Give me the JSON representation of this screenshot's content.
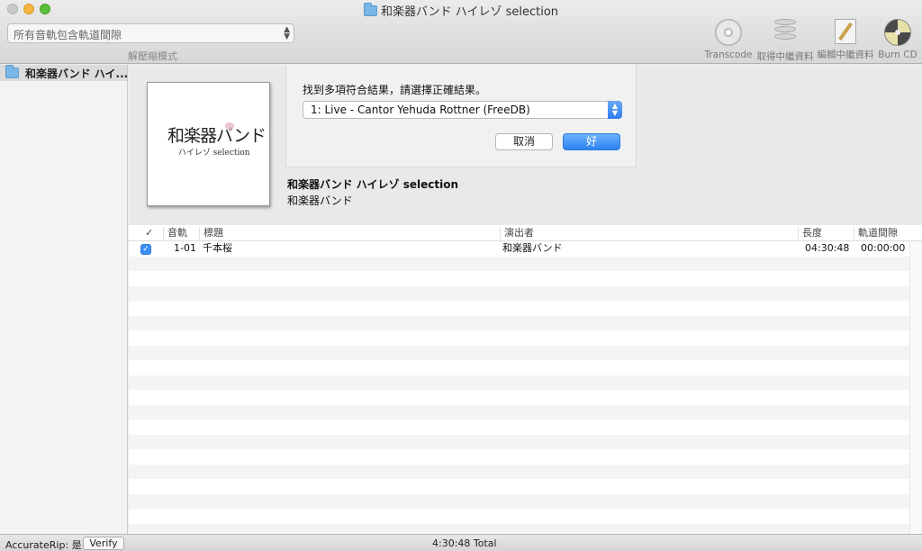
{
  "window": {
    "title": "和楽器バンド ハイレゾ selection"
  },
  "toolbar": {
    "mode_select_value": "所有音軌包含軌道間隙",
    "mode_caption": "解壓縮模式",
    "buttons": [
      {
        "label": "Transcode",
        "icon": "cd-icon"
      },
      {
        "label": "取得中繼資料",
        "icon": "database-icon"
      },
      {
        "label": "編輯中繼資料",
        "icon": "notepad-icon"
      },
      {
        "label": "Burn CD",
        "icon": "burn-cd-icon"
      }
    ]
  },
  "sidebar": {
    "items": [
      {
        "label": "和楽器バンド ハイ..."
      }
    ]
  },
  "album": {
    "cover_text_main": "和楽器バンド",
    "cover_text_sub": "ハイレゾ selection",
    "title": "和楽器バンド ハイレゾ selection",
    "artist": "和楽器バンド"
  },
  "sheet": {
    "message": "找到多項符合結果，請選擇正確結果。",
    "selected_result": "1: Live - Cantor Yehuda Rottner (FreeDB)",
    "cancel_label": "取消",
    "ok_label": "好"
  },
  "table": {
    "columns": {
      "check": "✓",
      "track": "音軌",
      "title": "標題",
      "artist": "演出者",
      "length": "長度",
      "gap": "軌道間隙"
    },
    "tracks": [
      {
        "checked": true,
        "number": "1-01",
        "title": "千本桜",
        "artist": "和楽器バンド",
        "length": "04:30:48",
        "gap": "00:00:00"
      }
    ]
  },
  "status": {
    "accuraterip_label": "AccurateRip: 是",
    "verify_label": "Verify",
    "total": "4:30:48 Total"
  },
  "colors": {
    "accent": "#2d82f1",
    "sidebar_selection": "#dcdcdc"
  }
}
